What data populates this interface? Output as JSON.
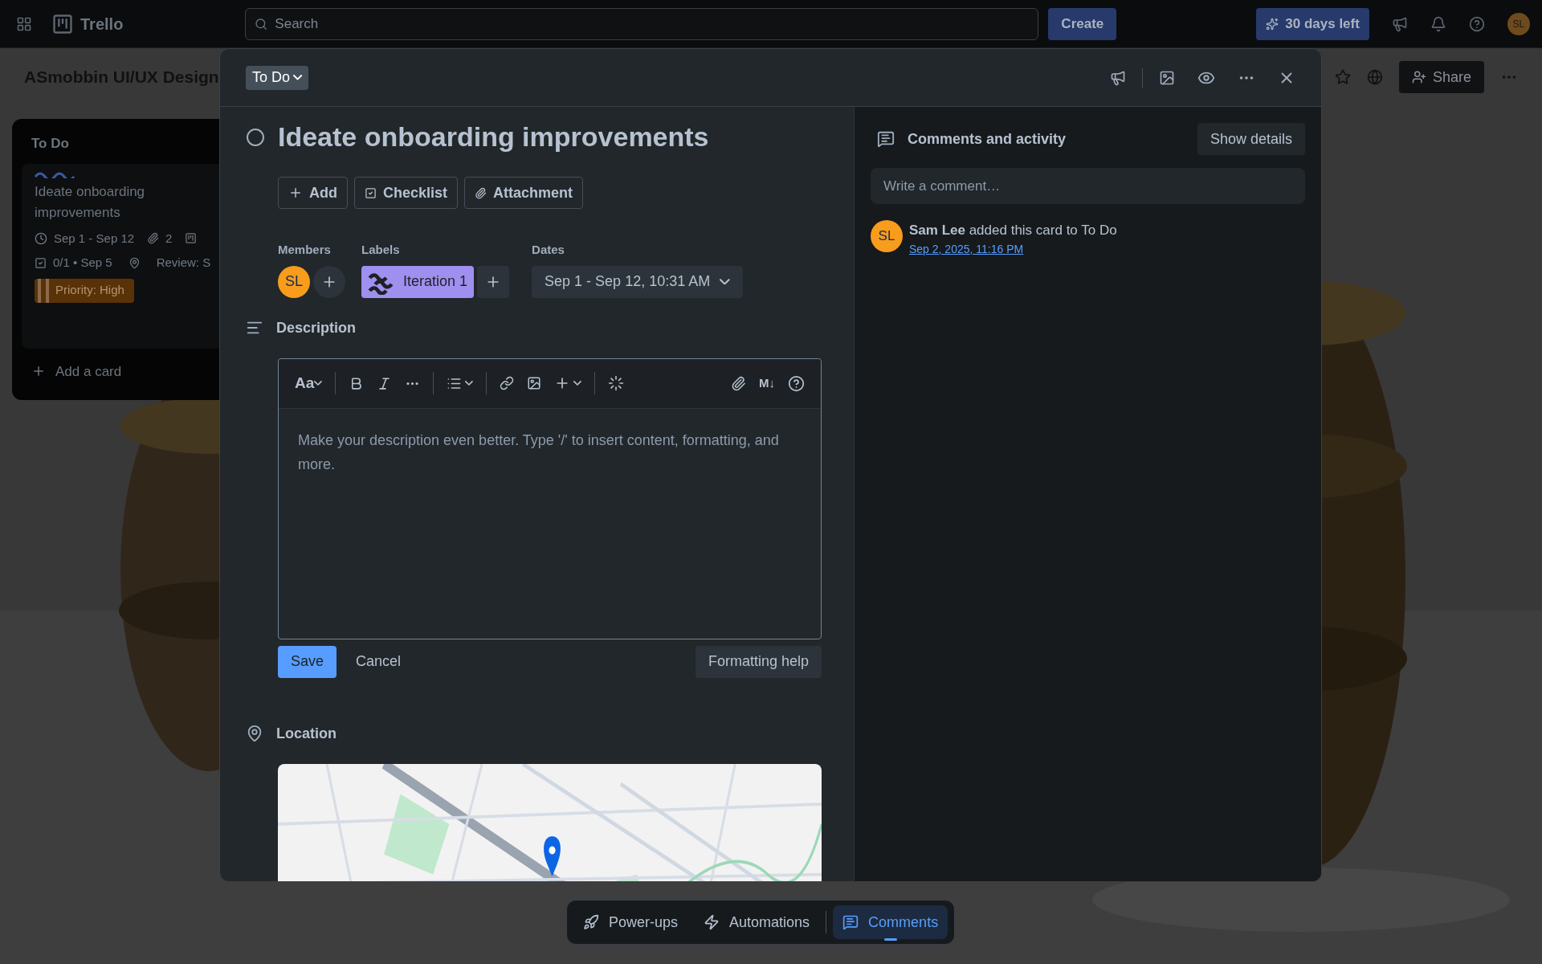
{
  "top_bar": {
    "app_name": "Trello",
    "search": {
      "placeholder": "Search"
    },
    "create_button": "Create",
    "trial_button": "30 days left",
    "avatar": "SL"
  },
  "board": {
    "title": "ASmobbin UI/UX Design",
    "share_button": "Share",
    "list": {
      "title": "To Do",
      "card": {
        "title": "Ideate onboarding improvements",
        "dates": "Sep 1 - Sep 12",
        "attachments": "2",
        "checklist": "0/1 • Sep 5",
        "custom_field": "Review: S",
        "label": {
          "text": "Priority: High",
          "color": "#5a3208"
        }
      },
      "add_card": "Add a card"
    }
  },
  "card_modal": {
    "list_button": "To Do",
    "title": "Ideate onboarding improvements",
    "completed": false,
    "actions": [
      "Add",
      "Checklist",
      "Attachment"
    ],
    "members_label": "Members",
    "members": [
      "SL"
    ],
    "labels_label": "Labels",
    "labels": [
      {
        "text": "Iteration 1",
        "color": "#9f8fef"
      }
    ],
    "dates_label": "Dates",
    "dates": "Sep 1 - Sep 12, 10:31 AM",
    "description_label": "Description",
    "editor": {
      "text_style": "Aa",
      "markdown": "M↓",
      "placeholder": "Make your description even better. Type '/' to insert content, formatting, and more."
    },
    "save_button": "Save",
    "cancel_button": "Cancel",
    "help_button": "Formatting help",
    "location_label": "Location"
  },
  "activity": {
    "title": "Comments and activity",
    "show_details": "Show details",
    "comment_field": {
      "placeholder": "Write a comment…"
    },
    "entries": [
      {
        "avatar": "SL",
        "text": "**Sam Lee** added this card to To Do",
        "time": "Sep 2, 2025, 11:16 PM"
      }
    ]
  },
  "bottom_nav": [
    {
      "label": "Power-ups",
      "selected": false
    },
    {
      "label": "Automations",
      "selected": false
    },
    {
      "label": "Comments",
      "selected": true
    }
  ]
}
